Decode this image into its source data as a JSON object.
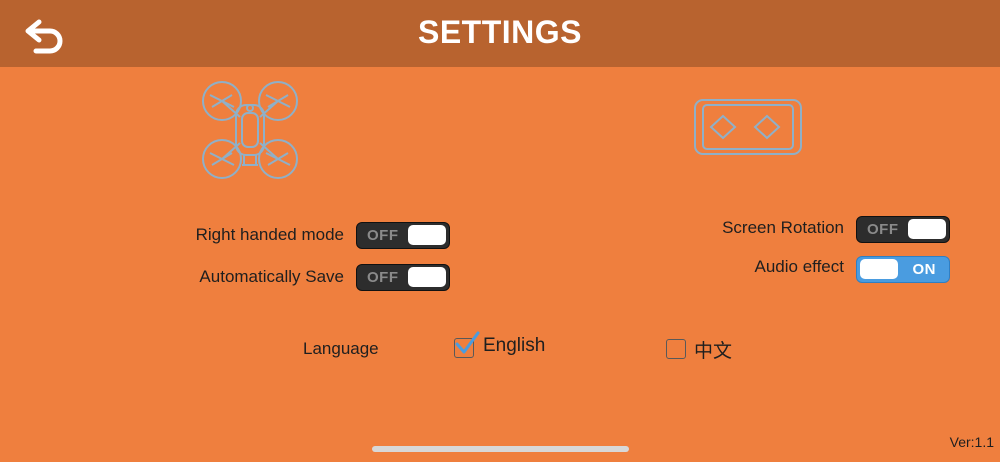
{
  "header": {
    "title": "SETTINGS",
    "back_icon": "back-arrow-icon"
  },
  "illustrations": {
    "drone_icon": "drone-icon",
    "controller_icon": "controller-icon"
  },
  "settings": {
    "right_handed_mode": {
      "label": "Right handed mode",
      "state_text": "OFF",
      "on": false
    },
    "automatically_save": {
      "label": "Automatically Save",
      "state_text": "OFF",
      "on": false
    },
    "screen_rotation": {
      "label": "Screen Rotation",
      "state_text": "OFF",
      "on": false
    },
    "audio_effect": {
      "label": "Audio effect",
      "state_text": "ON",
      "on": true
    }
  },
  "language": {
    "label": "Language",
    "options": [
      {
        "label": "English",
        "checked": true
      },
      {
        "label": "中文",
        "checked": false
      }
    ]
  },
  "footer": {
    "version": "Ver:1.1"
  },
  "colors": {
    "background": "#ef7f3e",
    "header": "#b8632f",
    "switch_on": "#4a9ce0",
    "switch_off": "#2d2d2d",
    "icon_stroke": "#8fb0c8"
  }
}
